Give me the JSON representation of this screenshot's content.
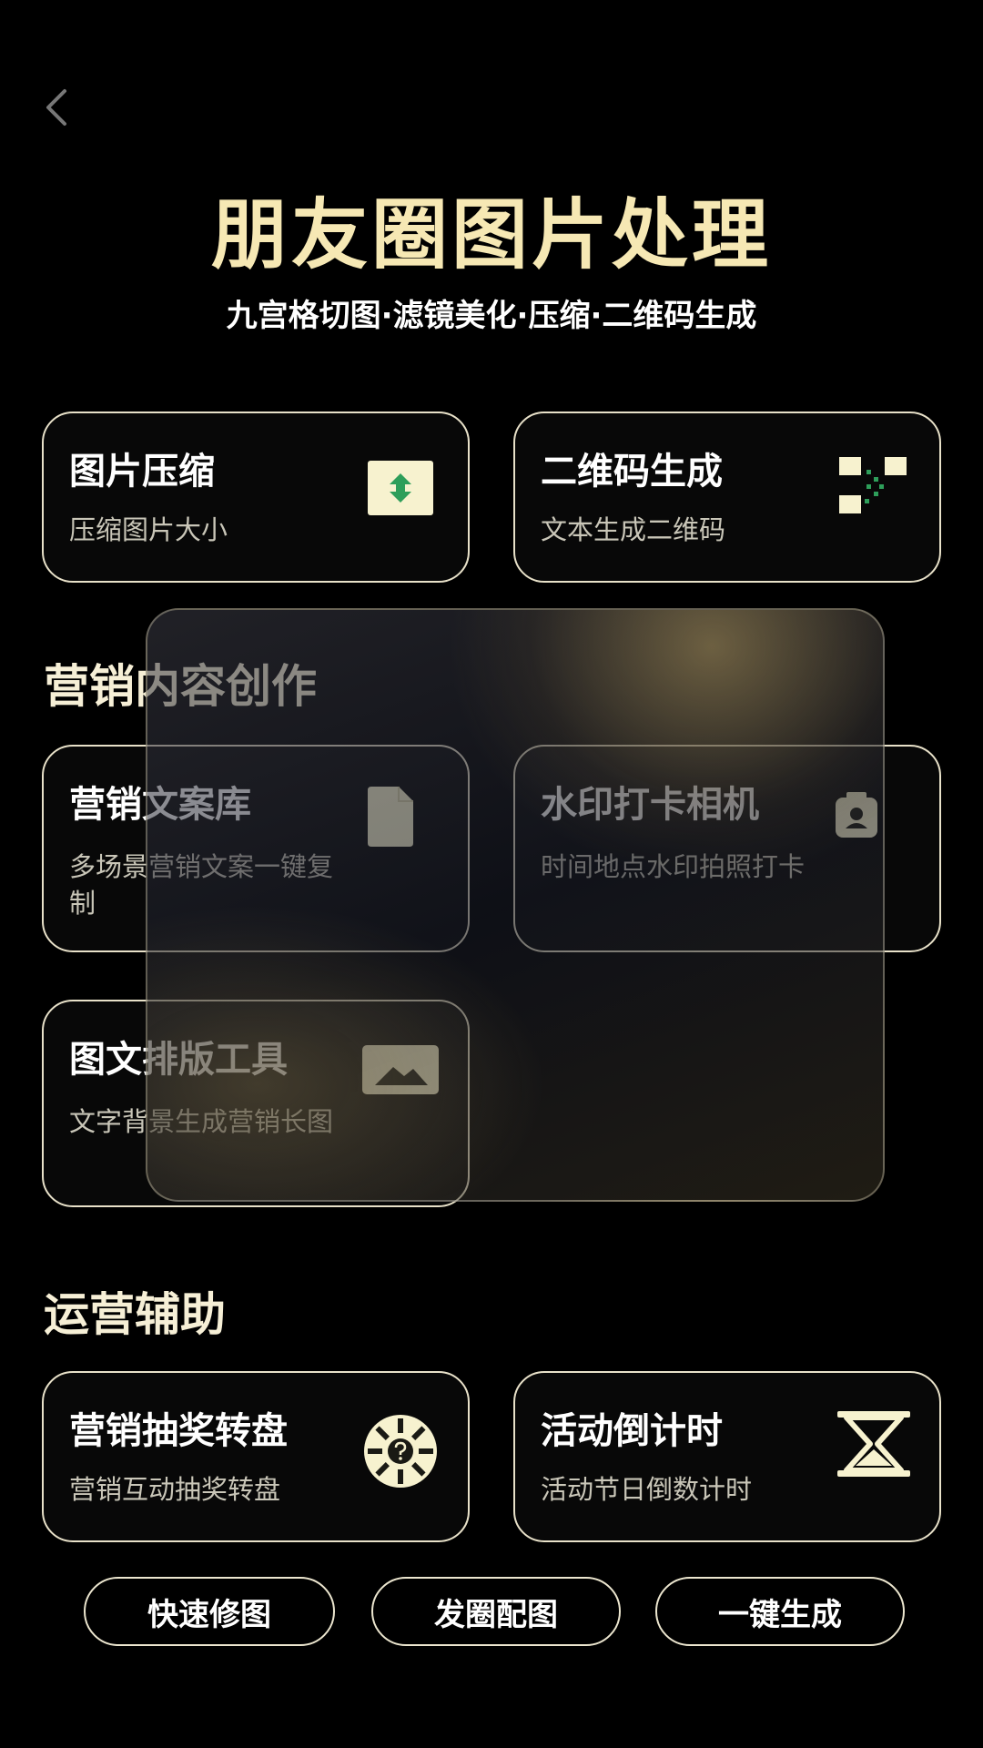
{
  "header": {
    "title": "朋友圈图片处理",
    "subtitle": "九宫格切图·滤镜美化·压缩·二维码生成"
  },
  "sections": {
    "marketing_title": "营销内容创作",
    "operations_title": "运营辅助"
  },
  "cards": {
    "compress": {
      "title": "图片压缩",
      "desc": "压缩图片大小",
      "icon": "compress-arrows-icon"
    },
    "qrcode": {
      "title": "二维码生成",
      "desc": "文本生成二维码",
      "icon": "qr-code-icon"
    },
    "copywriting": {
      "title": "营销文案库",
      "desc": "多场景营销文案一键复制",
      "icon": "document-icon"
    },
    "watermark": {
      "title": "水印打卡相机",
      "desc": "时间地点水印拍照打卡",
      "icon": "camera-icon"
    },
    "layout": {
      "title": "图文排版工具",
      "desc": "文字背景生成营销长图",
      "icon": "image-icon"
    },
    "lottery": {
      "title": "营销抽奖转盘",
      "desc": "营销互动抽奖转盘",
      "icon": "lottery-wheel-icon"
    },
    "countdown": {
      "title": "活动倒计时",
      "desc": "活动节日倒数计时",
      "icon": "hourglass-icon"
    }
  },
  "bottom_actions": [
    {
      "label": "快速修图"
    },
    {
      "label": "发圈配图"
    },
    {
      "label": "一键生成"
    }
  ],
  "colors": {
    "background": "#000000",
    "title": "#f6e8b4",
    "card_border": "#e8e1c9",
    "icon_fill": "#f7f2cf",
    "accent_green": "#2e9e5a"
  }
}
